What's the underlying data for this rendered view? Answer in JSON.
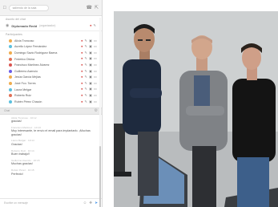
{
  "chat": {
    "header": {
      "title": "saliendo de la sala"
    },
    "subject": {
      "section_label": "Asunto del chat",
      "title": "Diplomado Redd",
      "tag": "(organizador)"
    },
    "participants_label": "Participantes",
    "participants": [
      {
        "name": "Alicia Troncoso",
        "color": "#f0ad4e"
      },
      {
        "name": "Aurelio López Fernández",
        "color": "#5bc0de"
      },
      {
        "name": "Domingo Savio Rodríguez Baena",
        "color": "#f0ad4e"
      },
      {
        "name": "Federico Divina",
        "color": "#e17055"
      },
      {
        "name": "Francisco Martínez Álvarez",
        "color": "#d9534f"
      },
      {
        "name": "Guillermo Asencio",
        "color": "#6c5ce7"
      },
      {
        "name": "Jesús García Mejías",
        "color": "#f0ad4e"
      },
      {
        "name": "José Fco. Torres",
        "color": "#f0ad4e"
      },
      {
        "name": "Laura Melgar",
        "color": "#5bc0de"
      },
      {
        "name": "Roberto Ruiz",
        "color": "#e17055"
      },
      {
        "name": "Rubén Pérez Chacón",
        "color": "#5bc0de"
      }
    ],
    "chat_section_label": "Chat",
    "messages": [
      {
        "meta": "Alicia Troncoso · 10:12",
        "text": "gracias!"
      },
      {
        "meta": "Francisco Martínez · 10:13",
        "text": "Muy interesante, te envío el email para implantarlo. ¡Muchas gracias!"
      },
      {
        "meta": "Laura Melgar · 10:14",
        "text": "Gracias!"
      },
      {
        "meta": "Roberto Ruiz · 10:14",
        "text": "Buen trabajo!!"
      },
      {
        "meta": "Guillermo Asencio · 10:15",
        "text": "Muchas gracias!"
      },
      {
        "meta": "Rubén Pérez · 10:15",
        "text": "Perfecto!"
      }
    ],
    "composer_placeholder": "Escribe un mensaje"
  },
  "icons": {
    "header_left": "chat-bubble-icon",
    "header_right": [
      "phone-icon",
      "expand-icon"
    ],
    "participant_actions": [
      "mic-muted-icon",
      "edit-icon",
      "camera-icon",
      "screen-share-icon"
    ],
    "composer": [
      "emoji-icon",
      "attach-icon",
      "send-icon"
    ]
  },
  "colors": {
    "accent": "#3a8ee6",
    "muted_red": "#d9534f",
    "wall": "#cfd2d3"
  }
}
